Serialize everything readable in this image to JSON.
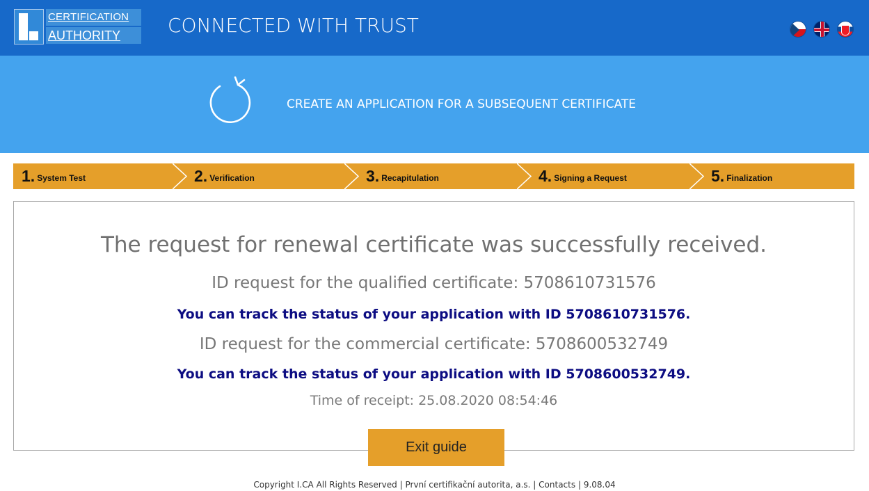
{
  "header": {
    "logo_line1": "CERTIFICATION",
    "logo_line2": "AUTHORITY",
    "title": "CONNECTED WITH TRUST",
    "background_color": "#1769c9",
    "flags": [
      "czech-flag-icon",
      "uk-flag-icon",
      "slovak-flag-icon"
    ]
  },
  "banner": {
    "icon": "refresh-icon",
    "title": "CREATE AN APPLICATION FOR A SUBSEQUENT CERTIFICATE",
    "background_color": "#44a3ee"
  },
  "steps": [
    {
      "number": "1.",
      "label": "System Test"
    },
    {
      "number": "2.",
      "label": "Verification"
    },
    {
      "number": "3.",
      "label": "Recapitulation"
    },
    {
      "number": "4.",
      "label": "Signing a Request"
    },
    {
      "number": "5.",
      "label": "Finalization"
    }
  ],
  "result": {
    "message": "The request for renewal certificate was successfully received.",
    "qualified_id_text": "ID request for the qualified certificate: 5708610731576",
    "qualified_track_text": "You can track the status of your application with ID 5708610731576.",
    "commercial_id_text": "ID request for the commercial certificate: 5708600532749",
    "commercial_track_text": "You can track the status of your application with ID 5708600532749.",
    "receipt_time": "Time of receipt: 25.08.2020 08:54:46"
  },
  "exit_button_label": "Exit guide",
  "footer": {
    "copyright": "Copyright I.CA All Rights Reserved",
    "company": "První certifikační autorita, a.s.",
    "contacts": "Contacts",
    "version": "9.08.04",
    "separator": "|"
  },
  "colors": {
    "accent_orange": "#e59f2a",
    "link_blue": "#0d0d82"
  }
}
